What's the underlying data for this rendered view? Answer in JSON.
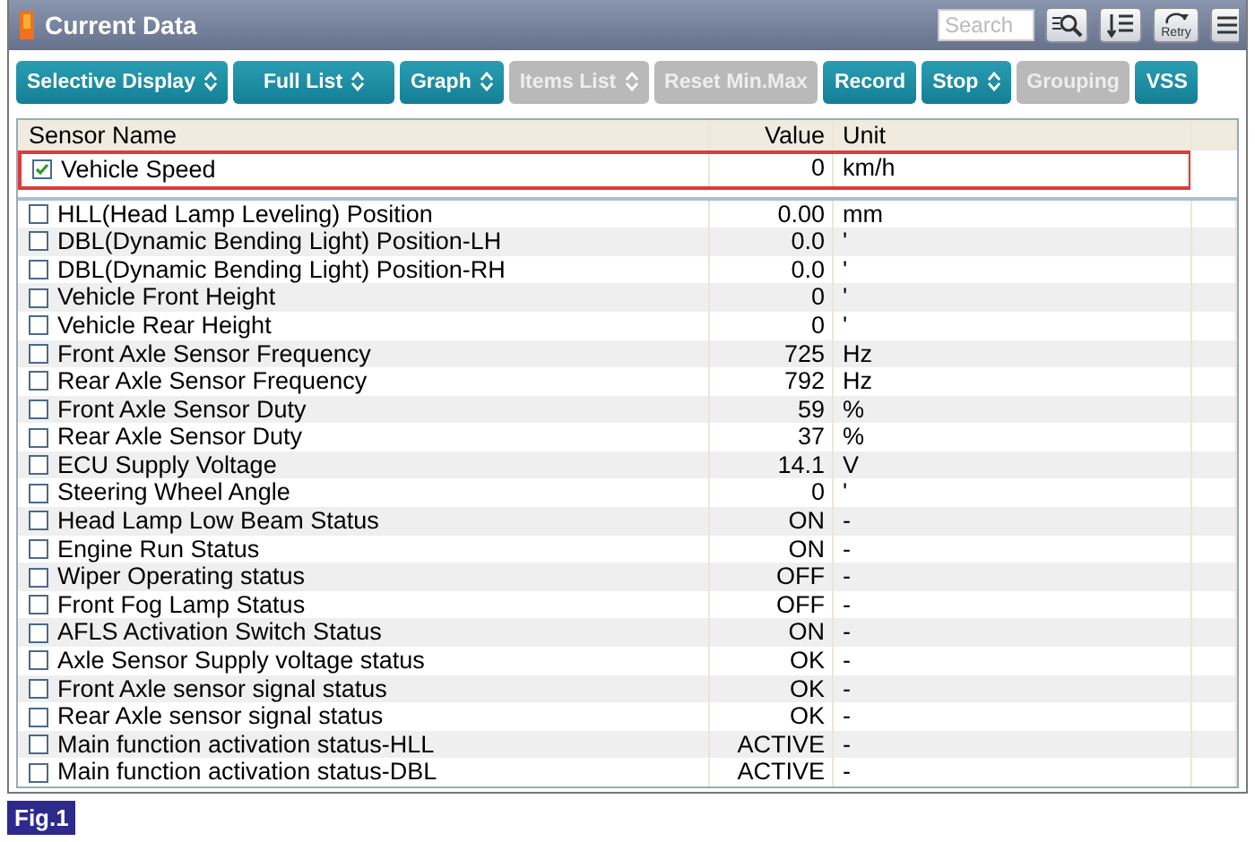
{
  "window": {
    "title": "Current Data"
  },
  "header": {
    "search": {
      "placeholder": "Search"
    },
    "retry_label": "Retry"
  },
  "toolbar": [
    {
      "label": "Selective Display",
      "dropdown": true,
      "disabled": false
    },
    {
      "label": "Full List",
      "dropdown": true,
      "disabled": false
    },
    {
      "label": "Graph",
      "dropdown": true,
      "disabled": false
    },
    {
      "label": "Items List",
      "dropdown": true,
      "disabled": true
    },
    {
      "label": "Reset Min.Max",
      "dropdown": false,
      "disabled": true
    },
    {
      "label": "Record",
      "dropdown": false,
      "disabled": false
    },
    {
      "label": "Stop",
      "dropdown": true,
      "disabled": false
    },
    {
      "label": "Grouping",
      "dropdown": false,
      "disabled": true
    },
    {
      "label": "VSS",
      "dropdown": false,
      "disabled": false
    }
  ],
  "table": {
    "columns": [
      "Sensor Name",
      "Value",
      "Unit"
    ],
    "pinned_rows": [
      {
        "name": "Vehicle Speed",
        "value": "0",
        "unit": "km/h",
        "checked": true,
        "highlighted": true
      }
    ],
    "rows": [
      {
        "name": "HLL(Head Lamp Leveling) Position",
        "value": "0.00",
        "unit": "mm",
        "checked": false
      },
      {
        "name": "DBL(Dynamic Bending Light) Position-LH",
        "value": "0.0",
        "unit": "'",
        "checked": false
      },
      {
        "name": "DBL(Dynamic Bending Light) Position-RH",
        "value": "0.0",
        "unit": "'",
        "checked": false
      },
      {
        "name": "Vehicle Front Height",
        "value": "0",
        "unit": "'",
        "checked": false
      },
      {
        "name": "Vehicle Rear Height",
        "value": "0",
        "unit": "'",
        "checked": false
      },
      {
        "name": "Front Axle Sensor Frequency",
        "value": "725",
        "unit": "Hz",
        "checked": false
      },
      {
        "name": "Rear Axle Sensor Frequency",
        "value": "792",
        "unit": "Hz",
        "checked": false
      },
      {
        "name": "Front Axle Sensor Duty",
        "value": "59",
        "unit": "%",
        "checked": false
      },
      {
        "name": "Rear Axle Sensor Duty",
        "value": "37",
        "unit": "%",
        "checked": false
      },
      {
        "name": "ECU Supply Voltage",
        "value": "14.1",
        "unit": "V",
        "checked": false
      },
      {
        "name": "Steering Wheel Angle",
        "value": "0",
        "unit": "'",
        "checked": false
      },
      {
        "name": "Head Lamp Low Beam Status",
        "value": "ON",
        "unit": "-",
        "checked": false
      },
      {
        "name": "Engine Run Status",
        "value": "ON",
        "unit": "-",
        "checked": false
      },
      {
        "name": "Wiper Operating status",
        "value": "OFF",
        "unit": "-",
        "checked": false
      },
      {
        "name": "Front Fog Lamp Status",
        "value": "OFF",
        "unit": "-",
        "checked": false
      },
      {
        "name": "AFLS Activation Switch Status",
        "value": "ON",
        "unit": "-",
        "checked": false
      },
      {
        "name": "Axle Sensor Supply voltage status",
        "value": "OK",
        "unit": "-",
        "checked": false
      },
      {
        "name": "Front Axle sensor signal status",
        "value": "OK",
        "unit": "-",
        "checked": false
      },
      {
        "name": "Rear Axle sensor signal status",
        "value": "OK",
        "unit": "-",
        "checked": false
      },
      {
        "name": "Main function activation status-HLL",
        "value": "ACTIVE",
        "unit": "-",
        "checked": false
      },
      {
        "name": "Main function activation status-DBL",
        "value": "ACTIVE",
        "unit": "-",
        "checked": false
      }
    ]
  },
  "figure_label": "Fig.1"
}
